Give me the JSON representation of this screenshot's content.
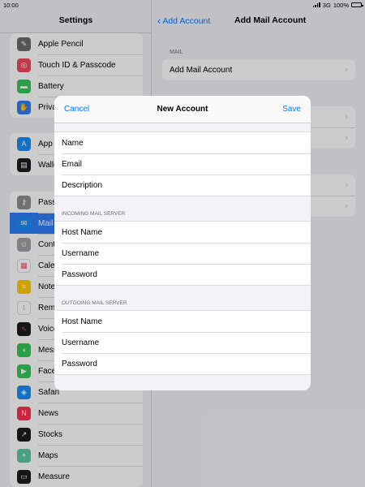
{
  "status": {
    "time": "10:00",
    "network": "3G",
    "battery": "100%"
  },
  "sidebar": {
    "title": "Settings",
    "groups": [
      {
        "items": [
          {
            "label": "Apple Pencil",
            "icon": "pencil-icon",
            "color": "#6b6b70",
            "glyph": "✎"
          },
          {
            "label": "Touch ID & Passcode",
            "icon": "fingerprint-icon",
            "color": "#f2495c",
            "glyph": "◎"
          },
          {
            "label": "Battery",
            "icon": "battery-icon",
            "color": "#34c759",
            "glyph": "▬"
          },
          {
            "label": "Privacy",
            "icon": "hand-icon",
            "color": "#2f7cf6",
            "glyph": "✋"
          }
        ]
      },
      {
        "items": [
          {
            "label": "App Store",
            "icon": "app-store-icon",
            "color": "#1a8cf5",
            "glyph": "A"
          },
          {
            "label": "Wallet & Apple Pay",
            "icon": "wallet-icon",
            "color": "#1c1c1e",
            "glyph": "▤"
          }
        ]
      },
      {
        "items": [
          {
            "label": "Passwords",
            "icon": "key-icon",
            "color": "#8e8e93",
            "glyph": "⚷"
          },
          {
            "label": "Mail",
            "icon": "mail-icon",
            "color": "#1a8cf5",
            "glyph": "✉",
            "selected": true
          },
          {
            "label": "Contacts",
            "icon": "contacts-icon",
            "color": "#a2a2a6",
            "glyph": "☺"
          },
          {
            "label": "Calendar",
            "icon": "calendar-icon",
            "color": "#ffffff",
            "glyph": "▦",
            "glyphColor": "#f2495c"
          },
          {
            "label": "Notes",
            "icon": "notes-icon",
            "color": "#ffcc00",
            "glyph": "≡"
          },
          {
            "label": "Reminders",
            "icon": "reminders-icon",
            "color": "#ffffff",
            "glyph": "⁝",
            "glyphColor": "#2f7cf6"
          },
          {
            "label": "Voice Memos",
            "icon": "voice-memos-icon",
            "color": "#1c1c1e",
            "glyph": "∿",
            "glyphColor": "#ff3b30"
          },
          {
            "label": "Messages",
            "icon": "messages-icon",
            "color": "#34c759",
            "glyph": "◖"
          },
          {
            "label": "FaceTime",
            "icon": "facetime-icon",
            "color": "#34c759",
            "glyph": "▶"
          },
          {
            "label": "Safari",
            "icon": "safari-icon",
            "color": "#1a8cf5",
            "glyph": "◈"
          },
          {
            "label": "News",
            "icon": "news-icon",
            "color": "#ff2d55",
            "glyph": "N"
          },
          {
            "label": "Stocks",
            "icon": "stocks-icon",
            "color": "#1c1c1e",
            "glyph": "↗"
          },
          {
            "label": "Maps",
            "icon": "maps-icon",
            "color": "#5ac8a0",
            "glyph": "⌖"
          },
          {
            "label": "Measure",
            "icon": "measure-icon",
            "color": "#1c1c1e",
            "glyph": "▭"
          }
        ]
      }
    ]
  },
  "detail": {
    "back_label": "Add Account",
    "title": "Add Mail Account",
    "section_caption": "MAIL",
    "add_mail_label": "Add Mail Account"
  },
  "modal": {
    "cancel_label": "Cancel",
    "title": "New Account",
    "save_label": "Save",
    "account_fields": [
      "Name",
      "Email",
      "Description"
    ],
    "incoming_caption": "INCOMING MAIL SERVER",
    "incoming_fields": [
      "Host Name",
      "Username",
      "Password"
    ],
    "outgoing_caption": "OUTGOING MAIL SERVER",
    "outgoing_fields": [
      "Host Name",
      "Username",
      "Password"
    ]
  }
}
